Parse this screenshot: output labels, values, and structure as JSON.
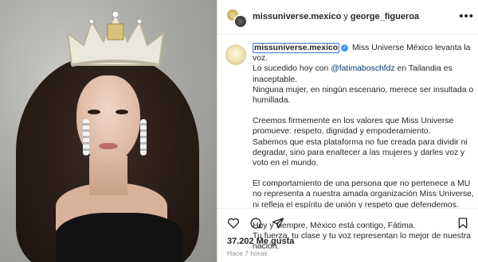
{
  "header": {
    "user1": "missuniverse.mexico",
    "connector": " y ",
    "user2": "george_figueroa",
    "more_icon": "more-dots-icon"
  },
  "caption": {
    "username": "missuniverse.mexico",
    "verified_icon": "verified-badge-icon",
    "p1_intro": " Miss Universe México levanta la voz.",
    "p1_line2_pre": "Lo sucedido hoy con ",
    "p1_mention": "@fatimaboschfdz",
    "p1_line2_post": " en Tailandia es inaceptable.",
    "p1_line3": "Ninguna mujer, en ningún escenario, merece ser insultada o humillada.",
    "p2_a": "Creemos firmemente en los valores que Miss Universe promueve: respeto, dignidad y empoderamiento.",
    "p2_b": "Sabemos que esta plataforma no fue creada para dividir ni degradar, sino para enaltecer a las mujeres y darles voz y voto en el mundo.",
    "p3": "El comportamiento de una persona que no pertenece a MU no representa a nuestra amada organización Miss Universe, ni refleja el espíritu de unión y respeto que defendemos.",
    "p4_a": "Hoy y siempre, México está contigo, Fátima.",
    "p4_b": "Tu fuerza, tu clase y tu voz representan lo mejor de nuestra nación."
  },
  "actions": {
    "like_icon": "heart-icon",
    "comment_icon": "comment-icon",
    "share_icon": "share-icon",
    "save_icon": "bookmark-icon"
  },
  "likes": "37.202 Me gusta",
  "time": "Hace 7 horas"
}
